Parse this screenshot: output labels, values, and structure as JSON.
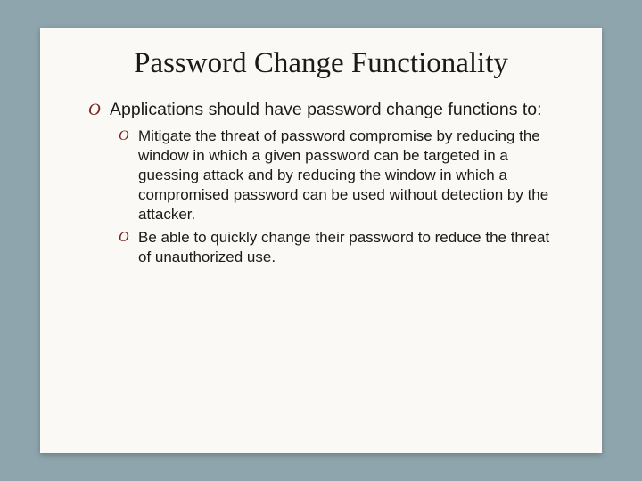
{
  "title": "Password Change Functionality",
  "bullet_marker": "O",
  "main": {
    "text": "Applications should have password change functions to:"
  },
  "sub": [
    {
      "text": "Mitigate the threat of password compromise by reducing the window in which a given password can be targeted in a guessing attack and by reducing the window in which a compromised password can be used without detection by the attacker."
    },
    {
      "text": "Be able to quickly change their password to reduce the threat of unauthorized use."
    }
  ]
}
